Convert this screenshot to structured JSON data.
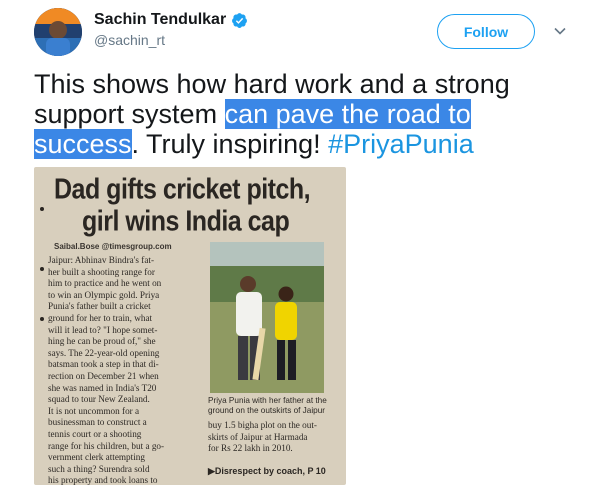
{
  "author": {
    "name": "Sachin Tendulkar",
    "handle": "@sachin_rt",
    "verified": true
  },
  "actions": {
    "follow_label": "Follow"
  },
  "tweet": {
    "text_plain_1": "This shows how hard work and a strong support system ",
    "text_highlighted": "can pave the road to success",
    "text_plain_2": ". Truly inspiring! ",
    "hashtag": "#PriyaPunia"
  },
  "image": {
    "headline_line1": "Dad gifts cricket pitch,",
    "headline_line2": "girl wins India cap",
    "byline": "Saibal.Bose @timesgroup.com",
    "body": [
      "Jaipur: Abhinav Bindra's fat-",
      "her built a shooting range for",
      "him to practice and he went on",
      "to win an Olympic gold. Priya",
      "Punia's father built a cricket",
      "ground for her to train, what",
      "will it lead to? \"I hope somet-",
      "hing he can be proud of,\" she",
      "says. The 22-year-old opening",
      "batsman took a step in that di-",
      "rection on December 21 when",
      "she was named in India's T20",
      "squad to tour New Zealand.",
      "It is not uncommon for a",
      "businessman to construct a",
      "tennis court or a shooting",
      "range for his children, but a go-",
      "vernment clerk attempting",
      "such a thing? Surendra sold",
      "his property and took loans to"
    ],
    "caption": "Priya Punia with her father at the ground on the outskirts of Jaipur",
    "body2": [
      "buy 1.5 bigha plot on the out-",
      "skirts of Jaipur at Harmada",
      "for Rs 22 lakh in 2010."
    ],
    "teaser": "▶Disrespect by coach, P 10"
  },
  "colors": {
    "accent": "#1da1f2",
    "hashtag": "#1b95e0",
    "selection": "#3b87e6",
    "muted": "#657786"
  },
  "icons": {
    "verified": "verified-badge-icon",
    "caret": "chevron-down-icon"
  }
}
